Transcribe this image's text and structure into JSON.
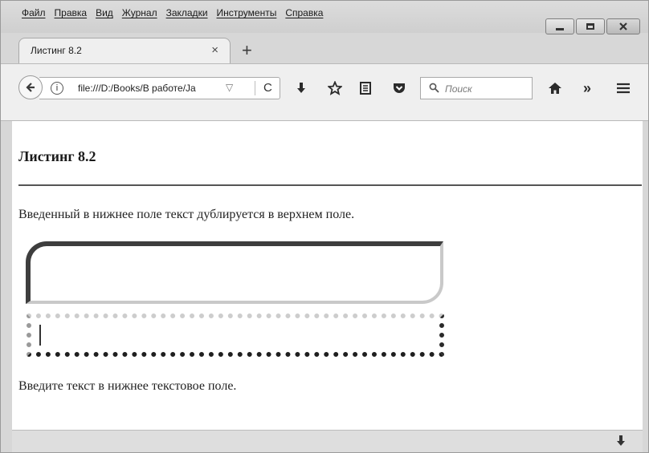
{
  "menu": [
    "Файл",
    "Правка",
    "Вид",
    "Журнал",
    "Закладки",
    "Инструменты",
    "Справка"
  ],
  "tab": {
    "title": "Листинг 8.2",
    "close": "×",
    "new_tab": "+"
  },
  "nav": {
    "url": "file:///D:/Books/В работе/Ja",
    "info": "i",
    "search_placeholder": "Поиск",
    "overflow": "»"
  },
  "page": {
    "heading": "Листинг 8.2",
    "description": "Введенный в нижнее поле текст дублируется в верхнем поле.",
    "upper_value": "",
    "lower_value": "",
    "instruction": "Введите текст в нижнее текстовое поле."
  },
  "icons": {
    "back": "back-arrow-icon",
    "reload": "reload-icon",
    "download": "download-icon",
    "bookmark": "star-icon",
    "reader": "reader-list-icon",
    "pocket": "pocket-icon",
    "home": "home-icon",
    "menu": "hamburger-menu-icon"
  }
}
